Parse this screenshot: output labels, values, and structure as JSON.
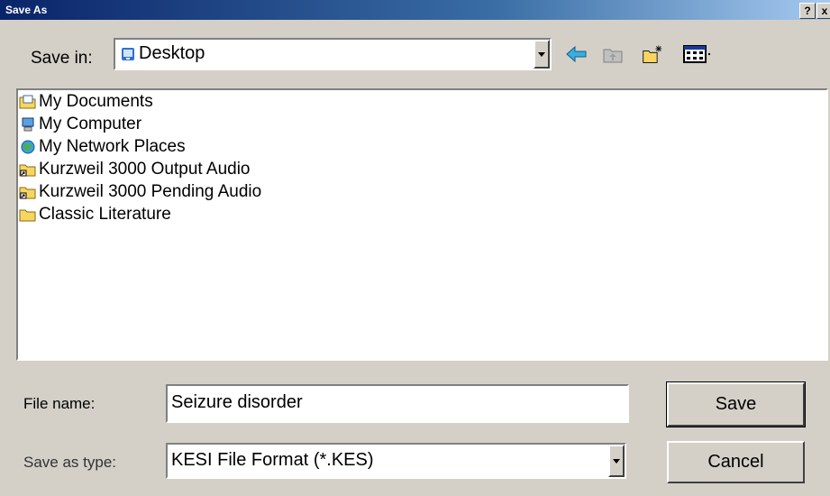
{
  "window": {
    "title": "Save As",
    "help_button": "?",
    "close_button": "x"
  },
  "toolbar": {
    "save_in_label": "Save in:",
    "save_in_value": "Desktop"
  },
  "file_list": [
    {
      "name": "My Documents",
      "icon": "my-documents-icon"
    },
    {
      "name": "My Computer",
      "icon": "my-computer-icon"
    },
    {
      "name": "My Network Places",
      "icon": "network-places-icon"
    },
    {
      "name": "Kurzweil 3000 Output Audio",
      "icon": "folder-shortcut-icon"
    },
    {
      "name": "Kurzweil 3000 Pending Audio",
      "icon": "folder-shortcut-icon"
    },
    {
      "name": "Classic Literature",
      "icon": "folder-icon"
    }
  ],
  "form": {
    "file_name_label": "File name:",
    "file_name_value": "Seizure disorder",
    "save_type_label": "Save as type:",
    "save_type_value": "KESI File Format (*.KES)"
  },
  "buttons": {
    "save": "Save",
    "cancel": "Cancel"
  }
}
